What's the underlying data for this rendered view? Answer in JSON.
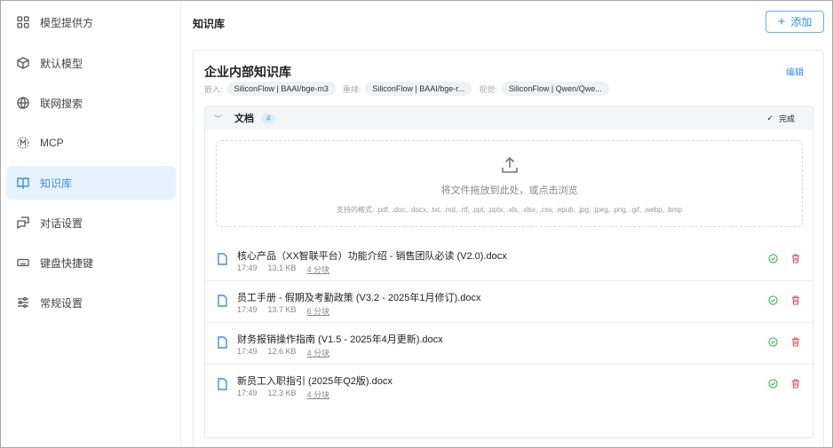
{
  "sidebar": {
    "items": [
      {
        "label": "模型提供方",
        "icon": "grid-icon"
      },
      {
        "label": "默认模型",
        "icon": "cube-icon"
      },
      {
        "label": "联网搜索",
        "icon": "globe-icon"
      },
      {
        "label": "MCP",
        "icon": "mcp-icon"
      },
      {
        "label": "知识库",
        "icon": "book-icon",
        "active": true
      },
      {
        "label": "对话设置",
        "icon": "chat-icon"
      },
      {
        "label": "键盘快捷键",
        "icon": "keyboard-icon"
      },
      {
        "label": "常规设置",
        "icon": "sliders-icon"
      }
    ]
  },
  "header": {
    "title": "知识库",
    "add_label": "添加"
  },
  "kb": {
    "title": "企业内部知识库",
    "edit_label": "编辑",
    "embed_label": "嵌入:",
    "embed_value": "SiliconFlow | BAAI/bge-m3",
    "rerank_label": "重排:",
    "rerank_value": "SiliconFlow | BAAI/bge-r...",
    "vision_label": "视觉:",
    "vision_value": "SiliconFlow | Qwen/Qwe...",
    "docs": {
      "title": "文档",
      "count": "4",
      "done_label": "完成",
      "drop_text": "将文件拖放到此处，或点击浏览",
      "formats": "支持的格式: .pdf, .doc, .docx, .txt, .md, .rtf, .ppt, .pptx, .xls, .xlsx, .csv, .epub, .jpg, .jpeg, .png, .gif, .webp, .bmp",
      "files": [
        {
          "name": "核心产品（XX智联平台）功能介绍 - 销售团队必读 (V2.0).docx",
          "time": "17:49",
          "size": "13.1 KB",
          "chunks": "4 分块"
        },
        {
          "name": "员工手册 - 假期及考勤政策 (V3.2 - 2025年1月修订).docx",
          "time": "17:49",
          "size": "13.7 KB",
          "chunks": "6 分块"
        },
        {
          "name": "财务报销操作指南 (V1.5 - 2025年4月更新).docx",
          "time": "17:49",
          "size": "12.6 KB",
          "chunks": "4 分块"
        },
        {
          "name": "新员工入职指引 (2025年Q2版).docx",
          "time": "17:49",
          "size": "12.3 KB",
          "chunks": "4 分块"
        }
      ]
    }
  },
  "colors": {
    "accent": "#3b8ee6",
    "success": "#3cb64a",
    "danger": "#e85050"
  }
}
